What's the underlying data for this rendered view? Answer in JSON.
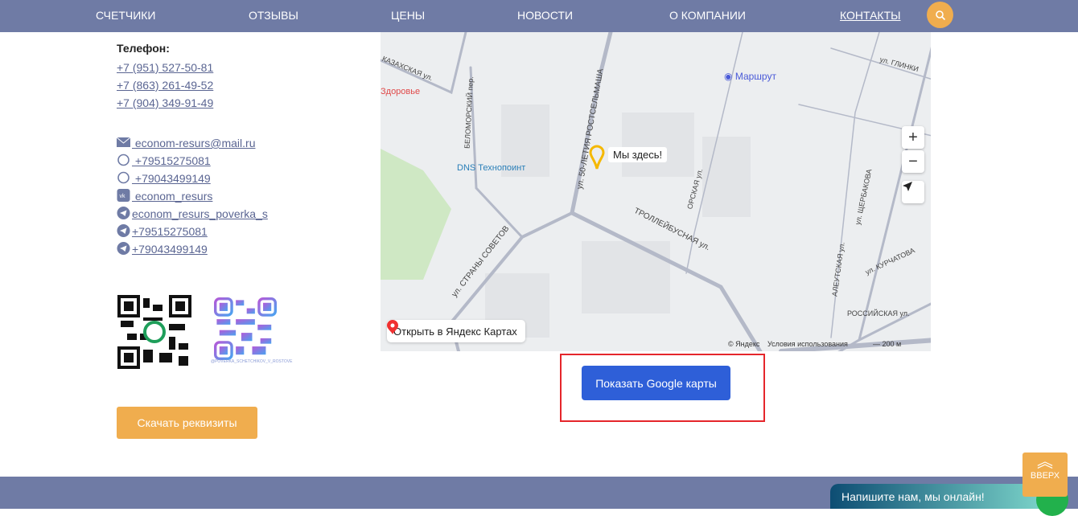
{
  "nav": {
    "items": [
      "СЧЕТЧИКИ",
      "ОТЗЫВЫ",
      "ЦЕНЫ",
      "НОВОСТИ",
      "О КОМПАНИИ",
      "КОНТАКТЫ"
    ],
    "active": "КОНТАКТЫ",
    "search_icon": "search-icon"
  },
  "contacts": {
    "phone_heading": "Телефон:",
    "phones": [
      "+7 (951) 527-50-81",
      "+7 (863) 261-49-52",
      "+7 (904) 349-91-49"
    ],
    "email": " econom-resurs@mail.ru",
    "whatsapp": [
      " +79515275081",
      " +79043499149"
    ],
    "vk": " econom_resurs",
    "telegram": [
      "econom_resurs_poverka_s",
      "+79515275081",
      "+79043499149"
    ]
  },
  "qr": {
    "caption": "@POVERKA_SCHETCHIKOV_V_ROSTOVE"
  },
  "download_button": "Скачать реквизиты",
  "map": {
    "labels": {
      "marker": "Мы здесь!",
      "route": "Маршрут",
      "dns": "DNS Технопоинт",
      "health": "Здоровье",
      "trolley": "ТРОЛЛЕЙБУСНАЯ ул.",
      "rostselmash": "ул. 50-ЛЕТИЯ РОСТСЕЛЬМАША",
      "sovetov": "ул. СТРАНЫ СОВЕТОВ",
      "belomor": "БЕЛОМОРСКИЙ пер.",
      "kazakh": "КАЗАХСКАЯ ул.",
      "orsk": "ОРСКАЯ ул.",
      "kurchatova": "ул. КУРЧАТОВА",
      "rossiyskaya": "РОССИЙСКАЯ ул.",
      "glinki": "ул. ГЛИНКИ",
      "shcherbakova": "ул. ЩЕРБАКОВА",
      "aleutskaya": "АЛЕУТСКАЯ ул."
    },
    "open_yandex": "Открыть в Яндекс Картах",
    "copyright": "© Яндекс",
    "terms": "Условия использования",
    "scale": "200 м",
    "zoom_in": "+",
    "zoom_out": "−"
  },
  "google_button": "Показать Google карты",
  "up_button": "ВВЕРХ",
  "chat": "Напишите нам, мы онлайн!"
}
